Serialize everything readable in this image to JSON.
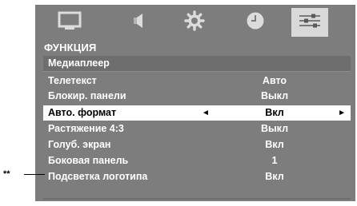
{
  "menu": {
    "title": "ФУНКЦИЯ",
    "tabs": [
      {
        "icon": "picture-icon",
        "active": false
      },
      {
        "icon": "sound-icon",
        "active": false
      },
      {
        "icon": "settings-gear-icon",
        "active": false
      },
      {
        "icon": "clock-icon",
        "active": false
      },
      {
        "icon": "function-sliders-icon",
        "active": true
      }
    ],
    "items": [
      {
        "label": "Медиаплеер",
        "value": ""
      },
      {
        "label": "Телетекст",
        "value": "Авто"
      },
      {
        "label": "Блокир. панели",
        "value": "Выкл"
      },
      {
        "label": "Авто. формат",
        "value": "Вкл",
        "left_arrow": "◄",
        "right_arrow": "►"
      },
      {
        "label": "Растяжение 4:3",
        "value": "Выкл"
      },
      {
        "label": "Голуб. экран",
        "value": "Вкл"
      },
      {
        "label": "Боковая панель",
        "value": "1"
      },
      {
        "label": "Подсветка логотипа",
        "value": "Вкл"
      }
    ]
  },
  "footnote": {
    "marker": "**"
  },
  "colors": {
    "panel": "#7d7d7d",
    "row_label_bg": "#6e6e6e",
    "row_value_bg": "#5a5a5a",
    "selected_bg": "#ffffff",
    "active_tab_bg": "#d9d9d9"
  }
}
